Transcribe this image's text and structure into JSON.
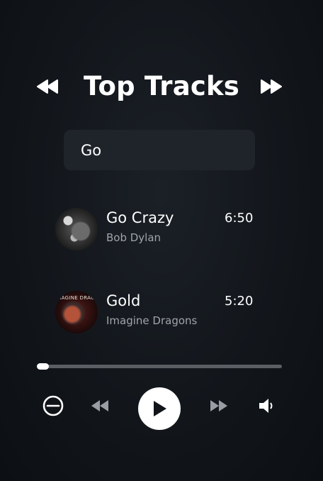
{
  "header": {
    "title": "Top Tracks",
    "prev_icon": "skip-backward-icon",
    "next_icon": "skip-forward-icon"
  },
  "search": {
    "value": "Go"
  },
  "tracks": [
    {
      "name": "Go Crazy",
      "artist": "Bob Dylan",
      "duration": "6:50",
      "cover_icon": "album-cover-bw-portrait"
    },
    {
      "name": "Gold",
      "artist": "Imagine Dragons",
      "duration": "5:20",
      "cover_icon": "album-cover-imagine-dragons",
      "cover_text": "IMAGINE DRAGONS"
    }
  ],
  "player": {
    "progress_fraction": 0.05,
    "controls": [
      "shuffle-off-icon",
      "rewind-icon",
      "play-icon",
      "fast-forward-icon",
      "volume-icon"
    ]
  },
  "colors": {
    "background": "#12161b",
    "search_bg": "#1f242a",
    "text_primary": "#ffffff",
    "text_secondary": "#a0a4aa",
    "progress_track": "#5b5f64",
    "progress_fill": "#ffffff",
    "play_button": "#ffffff"
  }
}
